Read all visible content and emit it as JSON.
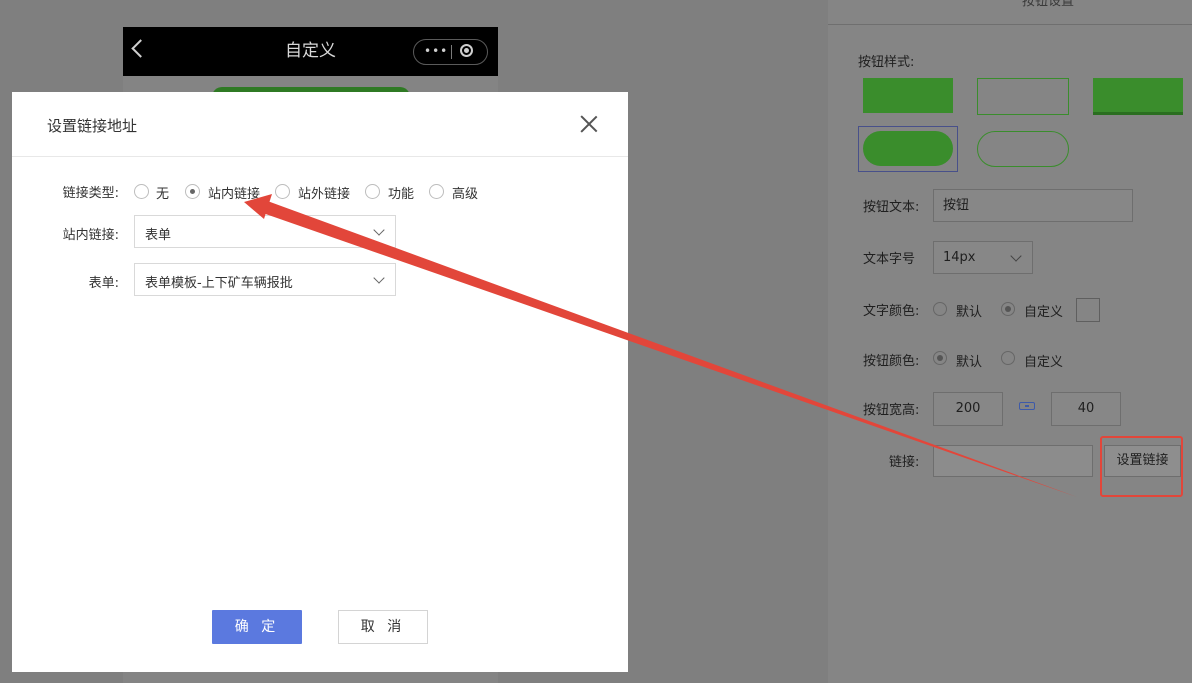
{
  "phone": {
    "title": "自定义",
    "capsule_dots": "•••"
  },
  "panel": {
    "title": "按钮设置",
    "style_label": "按钮样式:",
    "text_label": "按钮文本:",
    "text_value": "按钮",
    "size_label": "文本字号",
    "size_value": "14px",
    "text_color_label": "文字颜色:",
    "text_color_opt_default": "默认",
    "text_color_opt_custom": "自定义",
    "btn_color_label": "按钮颜色:",
    "btn_color_opt_default": "默认",
    "btn_color_opt_custom": "自定义",
    "wh_label": "按钮宽高:",
    "width_value": "200",
    "height_value": "40",
    "link_label": "链接:",
    "set_link_button": "设置链接"
  },
  "modal": {
    "title": "设置链接地址",
    "link_type_label": "链接类型:",
    "link_types": [
      "无",
      "站内链接",
      "站外链接",
      "功能",
      "高级"
    ],
    "selected_link_type": "站内链接",
    "internal_link_label": "站内链接:",
    "internal_link_value": "表单",
    "form_label": "表单:",
    "form_value": "表单模板-上下矿车辆报批",
    "ok_button": "确 定",
    "cancel_button": "取 消"
  },
  "colors": {
    "accent": "#5b79df",
    "button_green": "#3a8d2c",
    "annotation_red": "#e2463a"
  }
}
